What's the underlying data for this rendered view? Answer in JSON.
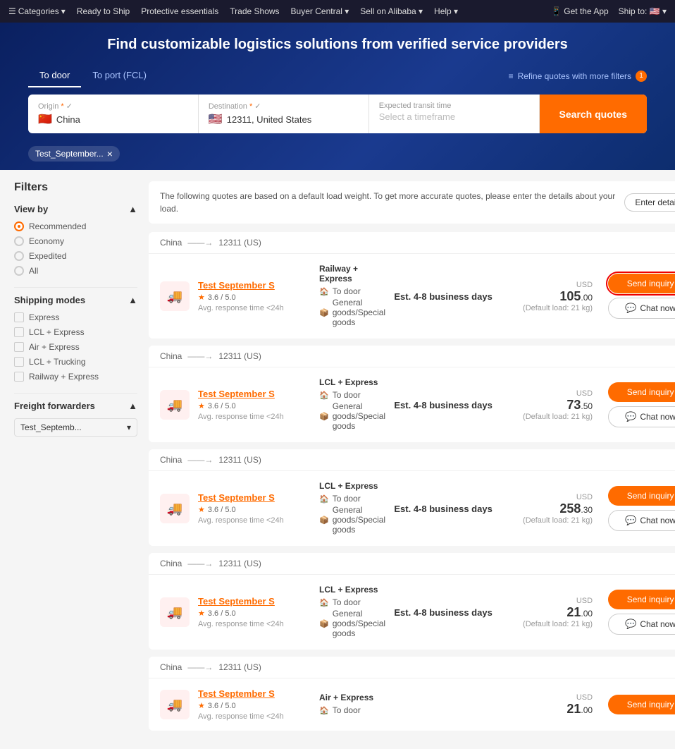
{
  "topNav": {
    "items": [
      "Categories",
      "Ready to Ship",
      "Protective essentials",
      "Trade Shows",
      "Buyer Central",
      "Sell on Alibaba",
      "Help"
    ],
    "right": [
      "Get the App",
      "Ship to: 🇺🇸"
    ]
  },
  "hero": {
    "title": "Find customizable logistics solutions from verified service providers",
    "tabs": [
      "To door",
      "To port (FCL)"
    ],
    "activeTab": 0,
    "refineLabel": "Refine quotes with more filters",
    "refineBadge": "1"
  },
  "searchBar": {
    "originLabel": "Origin",
    "originFlag": "🇨🇳",
    "originValue": "China",
    "destLabel": "Destination",
    "destFlag": "🇺🇸",
    "destValue": "12311, United States",
    "transitLabel": "Expected transit time",
    "transitPlaceholder": "Select a timeframe",
    "searchBtnLabel": "Search quotes"
  },
  "filterTags": [
    {
      "label": "Test_September...",
      "removable": true
    }
  ],
  "infoBanner": {
    "text": "The following quotes are based on a default load weight. To get more accurate quotes, please enter the details about your load.",
    "btnLabel": "Enter details"
  },
  "sidebar": {
    "title": "Filters",
    "viewByLabel": "View by",
    "viewByOptions": [
      "Recommended",
      "Economy",
      "Expedited",
      "All"
    ],
    "selectedViewBy": 0,
    "shippingModesLabel": "Shipping modes",
    "shippingModes": [
      "Express",
      "LCL + Express",
      "Air + Express",
      "LCL + Trucking",
      "Railway + Express"
    ],
    "freightForwardersLabel": "Freight forwarders",
    "freightForwardersValue": "Test_Septemb..."
  },
  "quotes": [
    {
      "routeFrom": "China",
      "routeTo": "12311 (US)",
      "providerName": "Test September S",
      "rating": "3.6",
      "ratingMax": "5.0",
      "response": "Avg. response time <24h",
      "mode": "Railway + Express",
      "doorTo": "To door",
      "goods": "General goods/Special goods",
      "transit": "Est. 4-8 business days",
      "priceUSD": "USD",
      "priceMain": "105",
      "priceCents": ".00",
      "priceNote": "(Default load: 21 kg)",
      "sendInquiryLabel": "Send inquiry",
      "chatLabel": "Chat now",
      "highlighted": true
    },
    {
      "routeFrom": "China",
      "routeTo": "12311 (US)",
      "providerName": "Test September S",
      "rating": "3.6",
      "ratingMax": "5.0",
      "response": "Avg. response time <24h",
      "mode": "LCL + Express",
      "doorTo": "To door",
      "goods": "General goods/Special goods",
      "transit": "Est. 4-8 business days",
      "priceUSD": "USD",
      "priceMain": "73",
      "priceCents": ".50",
      "priceNote": "(Default load: 21 kg)",
      "sendInquiryLabel": "Send inquiry",
      "chatLabel": "Chat now",
      "highlighted": false
    },
    {
      "routeFrom": "China",
      "routeTo": "12311 (US)",
      "providerName": "Test September S",
      "rating": "3.6",
      "ratingMax": "5.0",
      "response": "Avg. response time <24h",
      "mode": "LCL + Express",
      "doorTo": "To door",
      "goods": "General goods/Special goods",
      "transit": "Est. 4-8 business days",
      "priceUSD": "USD",
      "priceMain": "258",
      "priceCents": ".30",
      "priceNote": "(Default load: 21 kg)",
      "sendInquiryLabel": "Send inquiry",
      "chatLabel": "Chat now",
      "highlighted": false
    },
    {
      "routeFrom": "China",
      "routeTo": "12311 (US)",
      "providerName": "Test September S",
      "rating": "3.6",
      "ratingMax": "5.0",
      "response": "Avg. response time <24h",
      "mode": "LCL + Express",
      "doorTo": "To door",
      "goods": "General goods/Special goods",
      "transit": "Est. 4-8 business days",
      "priceUSD": "USD",
      "priceMain": "21",
      "priceCents": ".00",
      "priceNote": "(Default load: 21 kg)",
      "sendInquiryLabel": "Send inquiry",
      "chatLabel": "Chat now",
      "highlighted": false
    },
    {
      "routeFrom": "China",
      "routeTo": "12311 (US)",
      "providerName": "Test September S",
      "rating": "3.6",
      "ratingMax": "5.0",
      "response": "Avg. response time <24h",
      "mode": "Air + Express",
      "doorTo": "To door",
      "goods": "",
      "transit": "",
      "priceUSD": "USD",
      "priceMain": "21",
      "priceCents": ".00",
      "priceNote": "",
      "sendInquiryLabel": "Send inquiry",
      "chatLabel": "",
      "highlighted": false
    }
  ]
}
